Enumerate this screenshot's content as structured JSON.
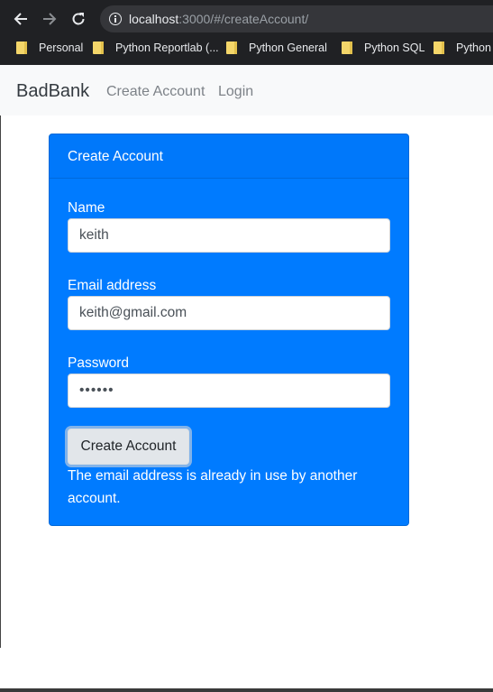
{
  "browser": {
    "url_host": "localhost",
    "url_path": ":3000/#/createAccount/",
    "bookmarks": [
      {
        "label": "Personal"
      },
      {
        "label": "Python Reportlab (..."
      },
      {
        "label": "Python General"
      },
      {
        "label": "Python SQL"
      },
      {
        "label": "Python E"
      }
    ]
  },
  "navbar": {
    "brand": "BadBank",
    "links": [
      "Create Account",
      "Login"
    ]
  },
  "card": {
    "header": "Create Account",
    "fields": [
      {
        "label": "Name",
        "value": "keith"
      },
      {
        "label": "Email address",
        "value": "keith@gmail.com"
      },
      {
        "label": "Password",
        "value": "••••••"
      }
    ],
    "submit_label": "Create Account",
    "status": "The email address is already in use by another account."
  },
  "colors": {
    "card_bg": "#007bff",
    "navbar_bg": "#f8f9fa",
    "browser_bg": "#202124"
  },
  "icons": [
    "back-arrow-icon",
    "forward-arrow-icon",
    "reload-icon",
    "info-icon",
    "folder-icon"
  ]
}
